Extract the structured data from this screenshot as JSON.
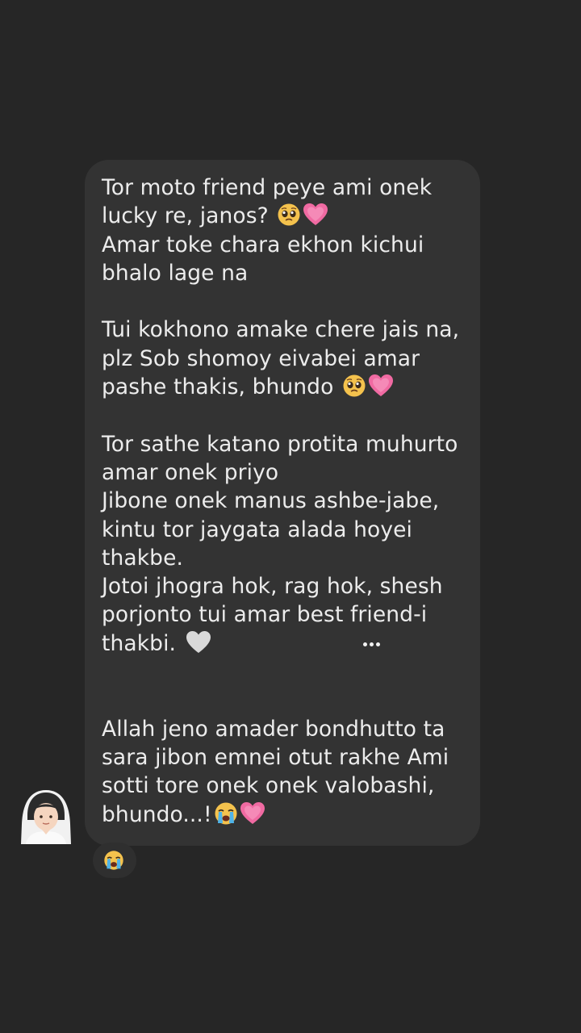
{
  "conversation": {
    "message": {
      "lines": {
        "l1": "Tor moto friend peye ami onek",
        "l2": "lucky re, janos?",
        "l3": "Amar toke chara ekhon kichui",
        "l4": "bhalo lage na",
        "l5": "Tui kokhono amake chere jais na,",
        "l6": "plz Sob shomoy eivabei amar",
        "l7": "pashe thakis, bhundo",
        "l8": "Tor sathe katano protita muhurto",
        "l9": "amar onek priyo",
        "l10": "Jibone onek manus ashbe-jabe,",
        "l11": "kintu tor jaygata alada hoyei",
        "l12": "thakbe.",
        "l13": "Jotoi jhogra hok, rag hok, shesh",
        "l14": "porjonto tui amar best friend-i",
        "l15": "thakbi.",
        "l16": "Allah jeno amader bondhutto ta",
        "l17": "sara jibon emnei otut rakhe Ami",
        "l18": "sotti tore onek onek valobashi,",
        "l19": "bhundo...!"
      },
      "emoji": {
        "l2": [
          "pleading-face",
          "growing-heart"
        ],
        "l7": [
          "pleading-face",
          "growing-heart"
        ],
        "l15": [
          "white-heart"
        ],
        "l19": [
          "loudly-crying-face",
          "growing-heart"
        ]
      },
      "menu_icon": "more-dots-icon"
    },
    "sender": {
      "avatar_icon": "bride-with-veil-emoji"
    },
    "reaction": {
      "emoji": "loudly-crying-face"
    }
  },
  "colors": {
    "background": "#262626",
    "bubble": "#333333",
    "text": "#ececec",
    "heart": "#f06aa2"
  }
}
